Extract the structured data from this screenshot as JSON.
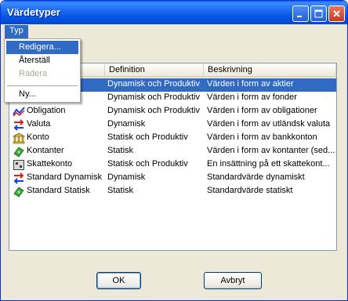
{
  "window": {
    "title": "Värdetyper",
    "controls": {
      "minimize": "minimize-icon",
      "maximize": "maximize-icon",
      "close": "close-icon"
    }
  },
  "menubar": {
    "typ": "Typ"
  },
  "menu": {
    "items": [
      {
        "label": "Redigera...",
        "state": "highlighted"
      },
      {
        "label": "Återställ",
        "state": "enabled"
      },
      {
        "label": "Radera",
        "state": "disabled"
      },
      {
        "label": "Ny...",
        "state": "enabled"
      }
    ]
  },
  "table": {
    "columns": [
      "Definition",
      "Beskrivning"
    ],
    "rows": [
      {
        "name": "",
        "definition": "Dynamisk och Produktiv",
        "description": "Värden i form av aktier",
        "icon": "stock-icon",
        "selected": true
      },
      {
        "name": "",
        "definition": "Dynamisk och Produktiv",
        "description": "Värden i form av fonder",
        "icon": "fund-icon"
      },
      {
        "name": "Obligation",
        "definition": "Dynamisk och Produktiv",
        "description": "Värden i form av obligationer",
        "icon": "bond-chart-icon"
      },
      {
        "name": "Valuta",
        "definition": "Dynamisk",
        "description": "Värden i form av utländsk valuta",
        "icon": "exchange-arrows-icon"
      },
      {
        "name": "Konto",
        "definition": "Statisk och Produktiv",
        "description": "Värden i form av bankkonton",
        "icon": "bank-icon"
      },
      {
        "name": "Kontanter",
        "definition": "Statisk",
        "description": "Värden i form av kontanter (sed...",
        "icon": "cash-icon"
      },
      {
        "name": "Skattekonto",
        "definition": "Statisk och Produktiv",
        "description": "En insättning på ett skattekont...",
        "icon": "tax-account-icon"
      },
      {
        "name": "Standard Dynamisk",
        "definition": "Dynamisk",
        "description": "Standardvärde dynamiskt",
        "icon": "exchange-arrows-icon"
      },
      {
        "name": "Standard Statisk",
        "definition": "Statisk",
        "description": "Standardvärde statiskt",
        "icon": "cash-icon"
      }
    ]
  },
  "buttons": {
    "ok": "OK",
    "cancel": "Avbryt"
  },
  "colors": {
    "title_bar": "#0454e0",
    "selection": "#316ac5",
    "window_bg": "#ece9d8"
  }
}
